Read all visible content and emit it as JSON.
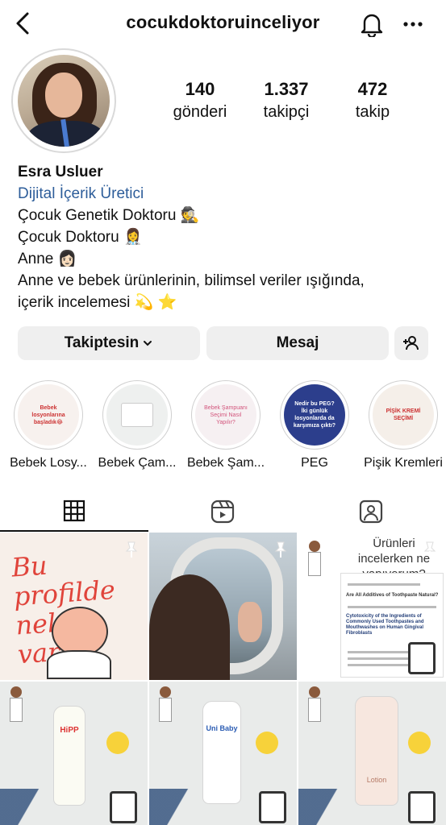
{
  "header": {
    "username": "cocukdoktoruinceliyor",
    "icons": {
      "back": "chevron-left-icon",
      "notifications": "bell-icon",
      "more": "more-horizontal-icon"
    }
  },
  "profile": {
    "stats": [
      {
        "value": "140",
        "label": "gönderi"
      },
      {
        "value": "1.337",
        "label": "takipçi"
      },
      {
        "value": "472",
        "label": "takip"
      }
    ],
    "name": "Esra Usluer",
    "category": "Dijital İçerik Üretici",
    "bio_lines": [
      "Çocuk Genetik Doktoru 🕵",
      "Çocuk Doktoru 👩‍⚕️",
      "Anne 👩🏻",
      "Anne ve bebek ürünlerinin, bilimsel veriler ışığında,",
      "içerik incelemesi 💫 ⭐"
    ]
  },
  "actions": {
    "follow_label": "Takiptesin",
    "message_label": "Mesaj"
  },
  "highlights": [
    {
      "label": "Bebek Losy...",
      "cover_text": "Bebek losyonlarına başladık😂"
    },
    {
      "label": "Bebek Çam...",
      "cover_text": ""
    },
    {
      "label": "Bebek Şam...",
      "cover_text": "Bebek Şampuanı Seçimi Nasıl Yapılır?"
    },
    {
      "label": "PEG",
      "cover_text": "Nedir bu PEG? İki günlük losyonlarda da karşımıza çıktı?"
    },
    {
      "label": "Pişik Kremleri",
      "cover_text": "PİŞİK KREMİ SEÇİMİ"
    }
  ],
  "posts": [
    {
      "title": "Bu profilde neler var?"
    },
    {
      "title": ""
    },
    {
      "title": "Ürünleri incelerken ne yapıyorum?",
      "doc_headings": [
        "Are All Additives of Toothpaste Natural?",
        "Cytotoxicity of the Ingredients of Commonly Used Toothpastes and Mouthwashes on Human Gingival Fibroblasts"
      ]
    },
    {
      "title": "",
      "brand": "HiPP"
    },
    {
      "title": "",
      "brand": "Uni Baby"
    },
    {
      "title": "",
      "brand": "Lotion"
    }
  ]
}
